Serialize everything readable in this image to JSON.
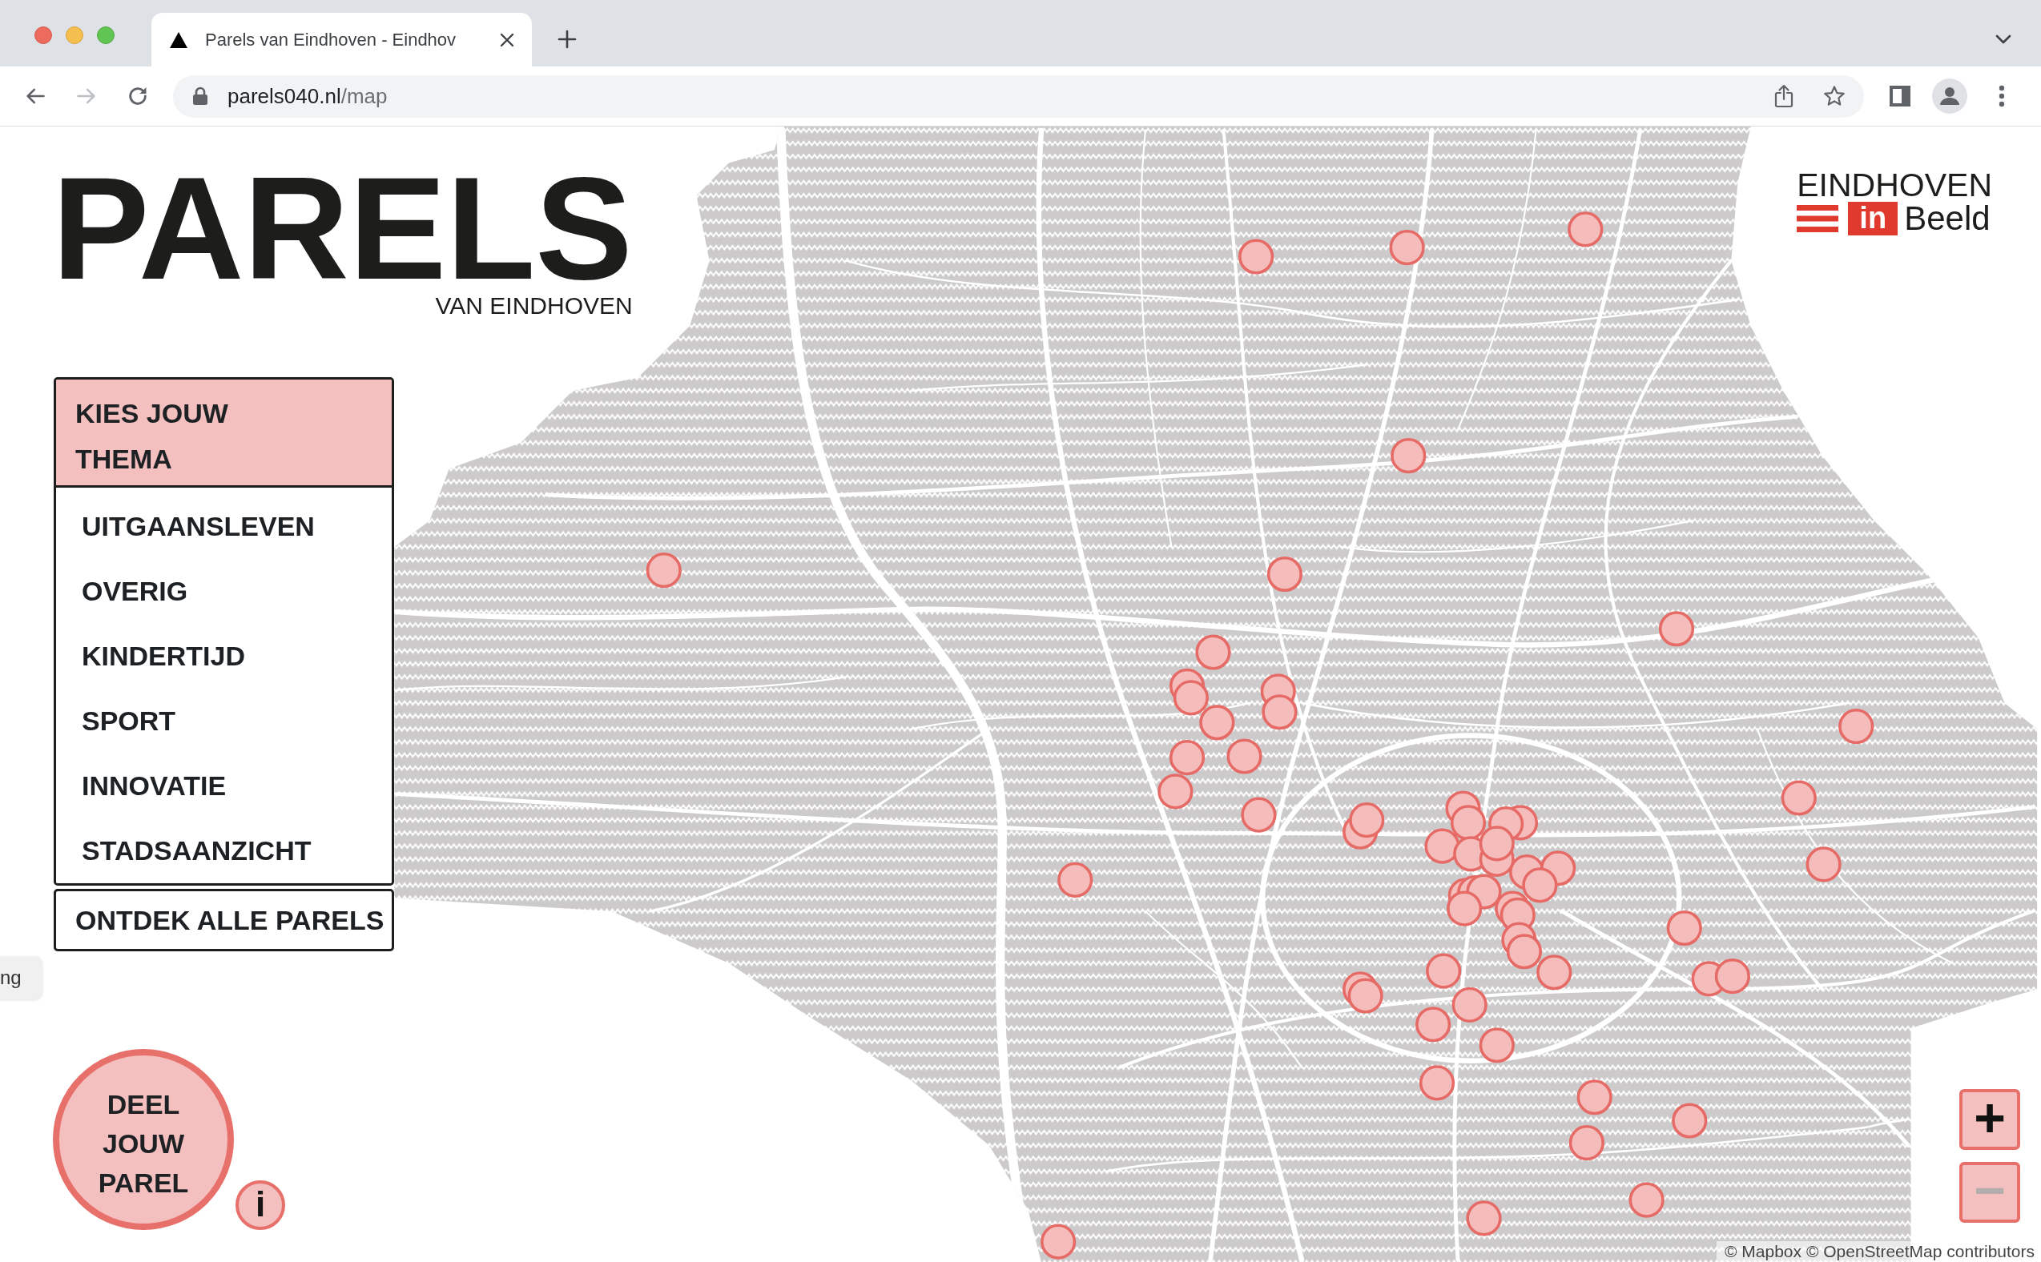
{
  "browser": {
    "tabs": [
      {
        "title": "Parels van Eindhoven - Eindhov",
        "selected": true
      }
    ],
    "nav_buttons": [
      {
        "kind": "back",
        "disabled": false
      },
      {
        "kind": "forward",
        "disabled": true
      },
      {
        "kind": "reload",
        "disabled": false
      }
    ],
    "address": {
      "host": "parels040.nl",
      "path": "/map"
    }
  },
  "logo": {
    "title": "PARELS",
    "subtitle": "VAN EINDHOVEN"
  },
  "partner_logo": {
    "top": "EINDHOVEN",
    "badge": "in",
    "bottom": "Beeld"
  },
  "theme_menu": {
    "title": "KIES JOUW THEMA",
    "items": [
      {
        "label": "UITGAANSLEVEN",
        "selected": false
      },
      {
        "label": "OVERIG",
        "selected": false
      },
      {
        "label": "KINDERTIJD",
        "selected": false
      },
      {
        "label": "SPORT",
        "selected": false
      },
      {
        "label": "INNOVATIE",
        "selected": false
      },
      {
        "label": "STADSAANZICHT",
        "selected": false
      }
    ]
  },
  "discover_button": {
    "label": "ONTDEK ALLE PARELS"
  },
  "tooltip": {
    "text": "ng"
  },
  "share_button": {
    "label": "DEEL JOUW PAREL"
  },
  "info_button": {
    "label": "i"
  },
  "zoom_controls": [
    {
      "label": "+",
      "disabled": false
    },
    {
      "label": "−",
      "disabled": true
    }
  ],
  "attribution": "© Mapbox © OpenStreetMap contributors"
}
